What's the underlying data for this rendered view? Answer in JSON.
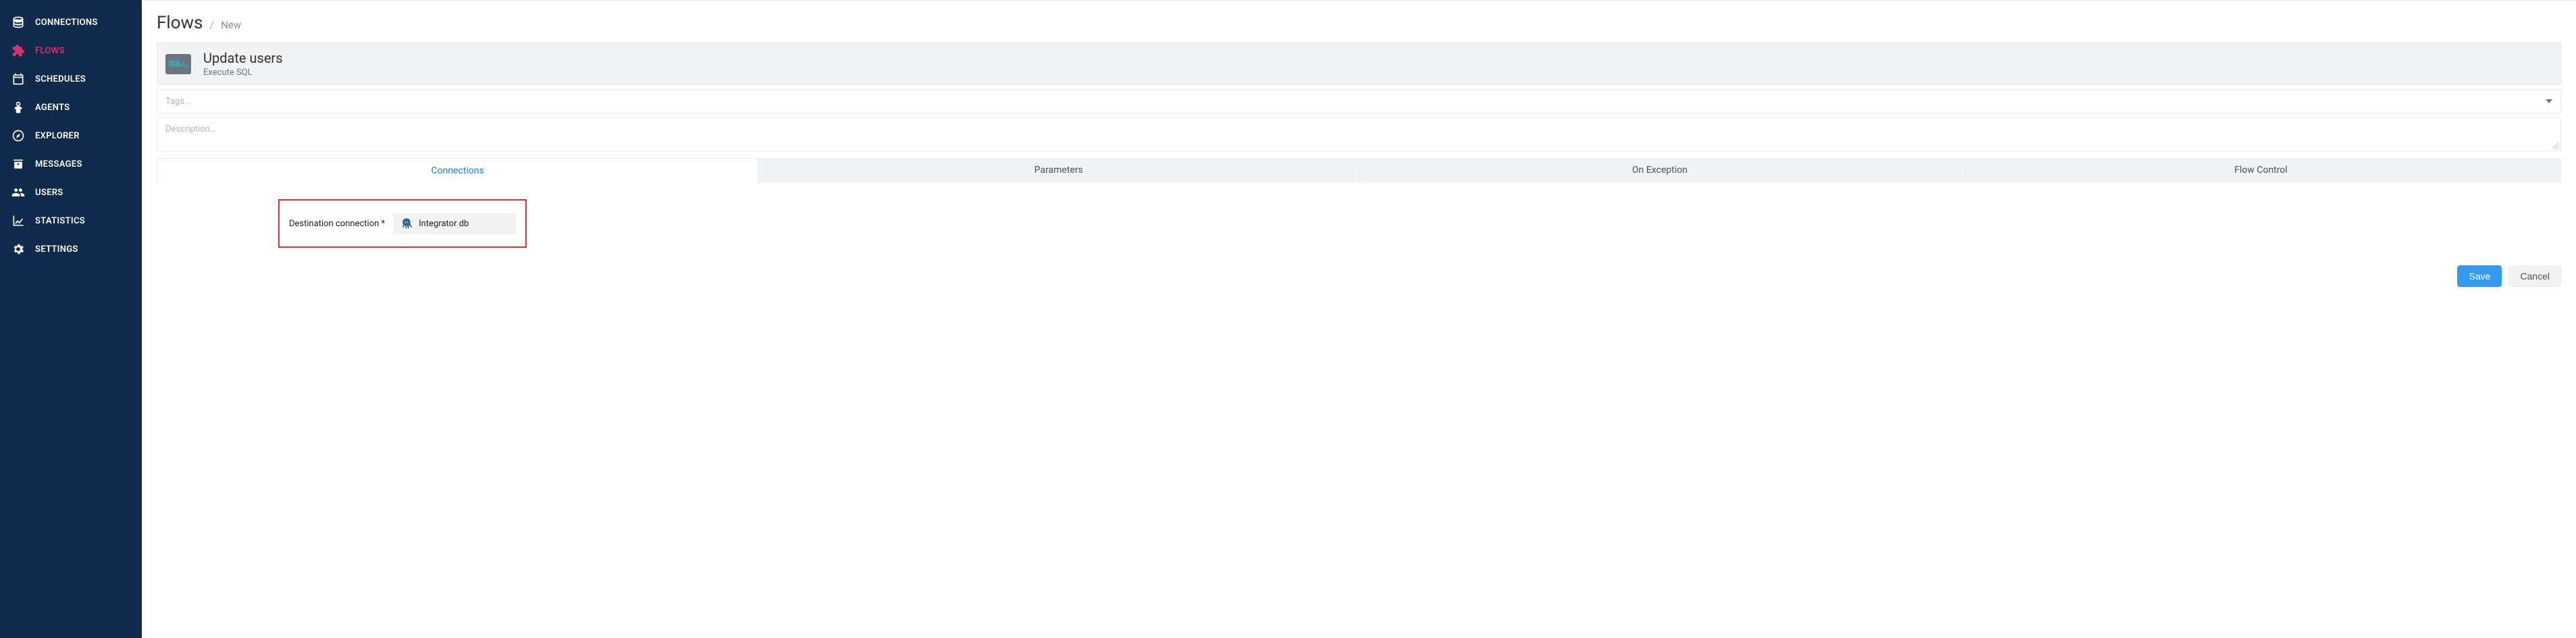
{
  "sidebar": {
    "items": [
      {
        "label": "CONNECTIONS",
        "name": "sidebar-item-connections",
        "icon": "database",
        "active": false
      },
      {
        "label": "FLOWS",
        "name": "sidebar-item-flows",
        "icon": "puzzle",
        "active": true
      },
      {
        "label": "SCHEDULES",
        "name": "sidebar-item-schedules",
        "icon": "calendar",
        "active": false
      },
      {
        "label": "AGENTS",
        "name": "sidebar-item-agents",
        "icon": "agent",
        "active": false
      },
      {
        "label": "EXPLORER",
        "name": "sidebar-item-explorer",
        "icon": "compass",
        "active": false
      },
      {
        "label": "MESSAGES",
        "name": "sidebar-item-messages",
        "icon": "archive",
        "active": false
      },
      {
        "label": "USERS",
        "name": "sidebar-item-users",
        "icon": "users",
        "active": false
      },
      {
        "label": "STATISTICS",
        "name": "sidebar-item-statistics",
        "icon": "chart",
        "active": false
      },
      {
        "label": "SETTINGS",
        "name": "sidebar-item-settings",
        "icon": "cogs",
        "active": false
      }
    ]
  },
  "breadcrumb": {
    "title": "Flows",
    "current": "New"
  },
  "flow": {
    "badge": "SQL>_",
    "title": "Update users",
    "subtitle": "Execute SQL",
    "tags_placeholder": "Tags...",
    "description_placeholder": "Description..."
  },
  "tabs": [
    {
      "label": "Connections",
      "name": "tab-connections",
      "active": true
    },
    {
      "label": "Parameters",
      "name": "tab-parameters",
      "active": false
    },
    {
      "label": "On Exception",
      "name": "tab-on-exception",
      "active": false
    },
    {
      "label": "Flow Control",
      "name": "tab-flow-control",
      "active": false
    }
  ],
  "form": {
    "destination_label": "Destination connection *",
    "destination_value": "Integrator db"
  },
  "buttons": {
    "save": "Save",
    "cancel": "Cancel"
  }
}
